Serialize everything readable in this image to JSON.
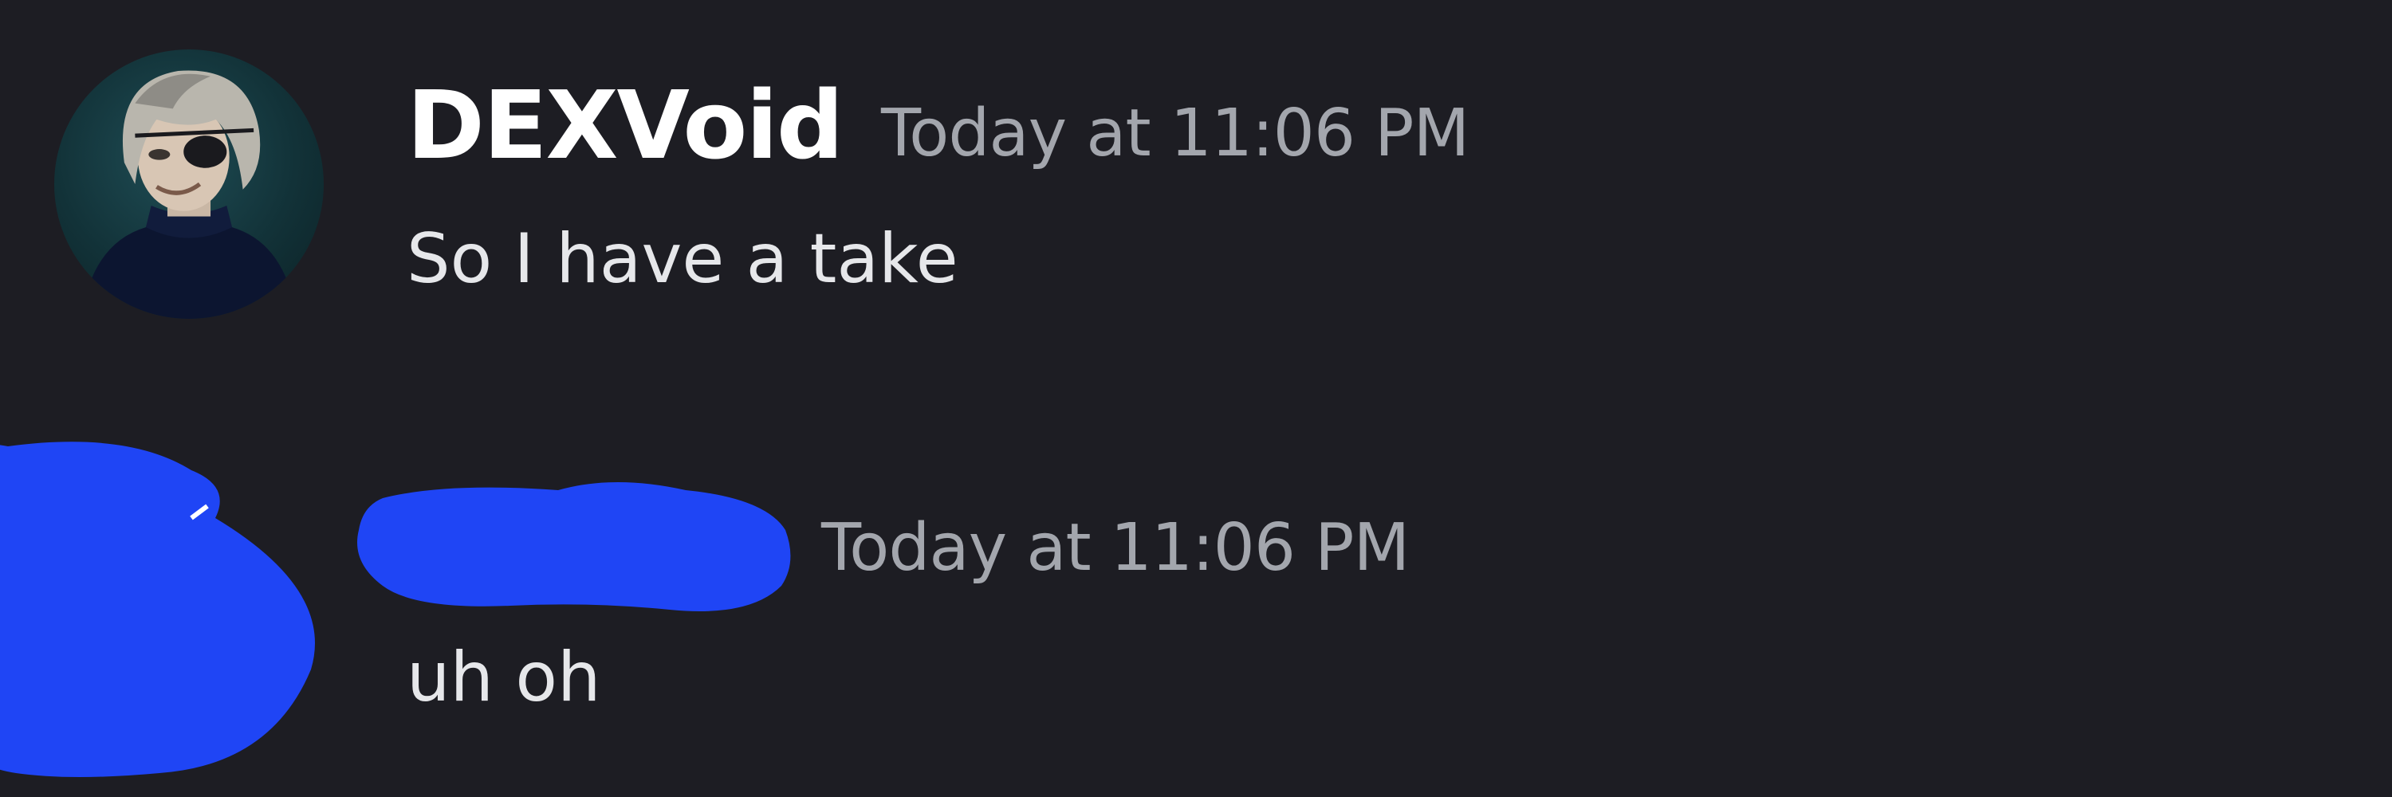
{
  "messages": [
    {
      "username": "DEXVoid",
      "timestamp": "Today at 11:06 PM",
      "content": "So I have a take",
      "avatar": "anime-character-avatar"
    },
    {
      "username": "",
      "timestamp": "Today at 11:06 PM",
      "content": "uh oh",
      "avatar": "redacted-avatar"
    }
  ],
  "colors": {
    "background": "#1d1d23",
    "username": "#ffffff",
    "timestamp": "#a3a6ad",
    "content": "#e6e7ea",
    "redaction": "#1f45f5"
  }
}
